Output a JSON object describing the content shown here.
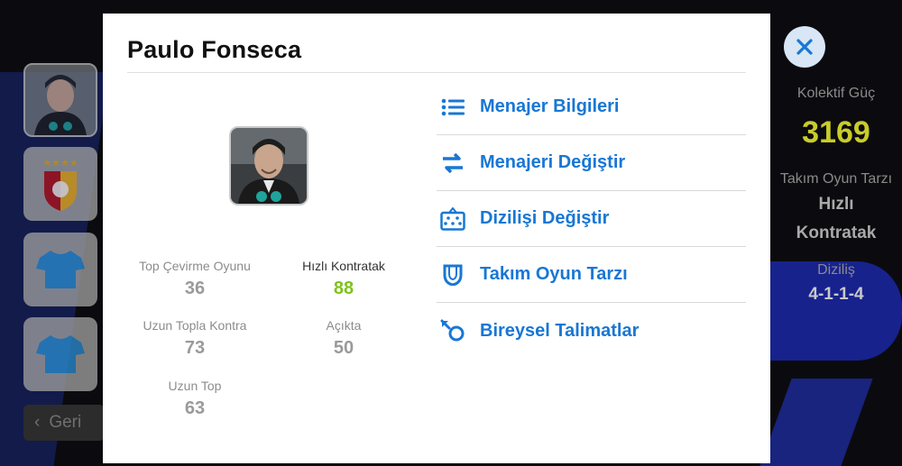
{
  "background": {
    "back_label": "Geri",
    "team_strength_label": "Kolektif Güç",
    "team_strength_value": "3169",
    "playstyle_label": "Takım Oyun Tarzı",
    "playstyle_value_line1": "Hızlı",
    "playstyle_value_line2": "Kontratak",
    "formation_label": "Diziliş",
    "formation_value": "4-1-1-4"
  },
  "modal": {
    "title": "Paulo Fonseca",
    "stats": [
      {
        "label": "Top Çevirme Oyunu",
        "value": "36",
        "highlight": false
      },
      {
        "label": "Hızlı Kontratak",
        "value": "88",
        "highlight": true
      },
      {
        "label": "Uzun Topla Kontra",
        "value": "73",
        "highlight": false
      },
      {
        "label": "Açıkta",
        "value": "50",
        "highlight": false
      },
      {
        "label": "Uzun Top",
        "value": "63",
        "highlight": false
      }
    ],
    "menu": [
      {
        "label": "Menajer Bilgileri",
        "icon": "list-icon"
      },
      {
        "label": "Menajeri Değiştir",
        "icon": "swap-arrows-icon"
      },
      {
        "label": "Dizilişi Değiştir",
        "icon": "formation-board-icon"
      },
      {
        "label": "Takım Oyun Tarzı",
        "icon": "shield-icon"
      },
      {
        "label": "Bireysel Talimatlar",
        "icon": "individual-instruction-icon"
      }
    ]
  },
  "colors": {
    "accent_blue": "#1877d4",
    "highlight_green": "#7fc31c",
    "strength_yellow": "#d8dc3a"
  }
}
